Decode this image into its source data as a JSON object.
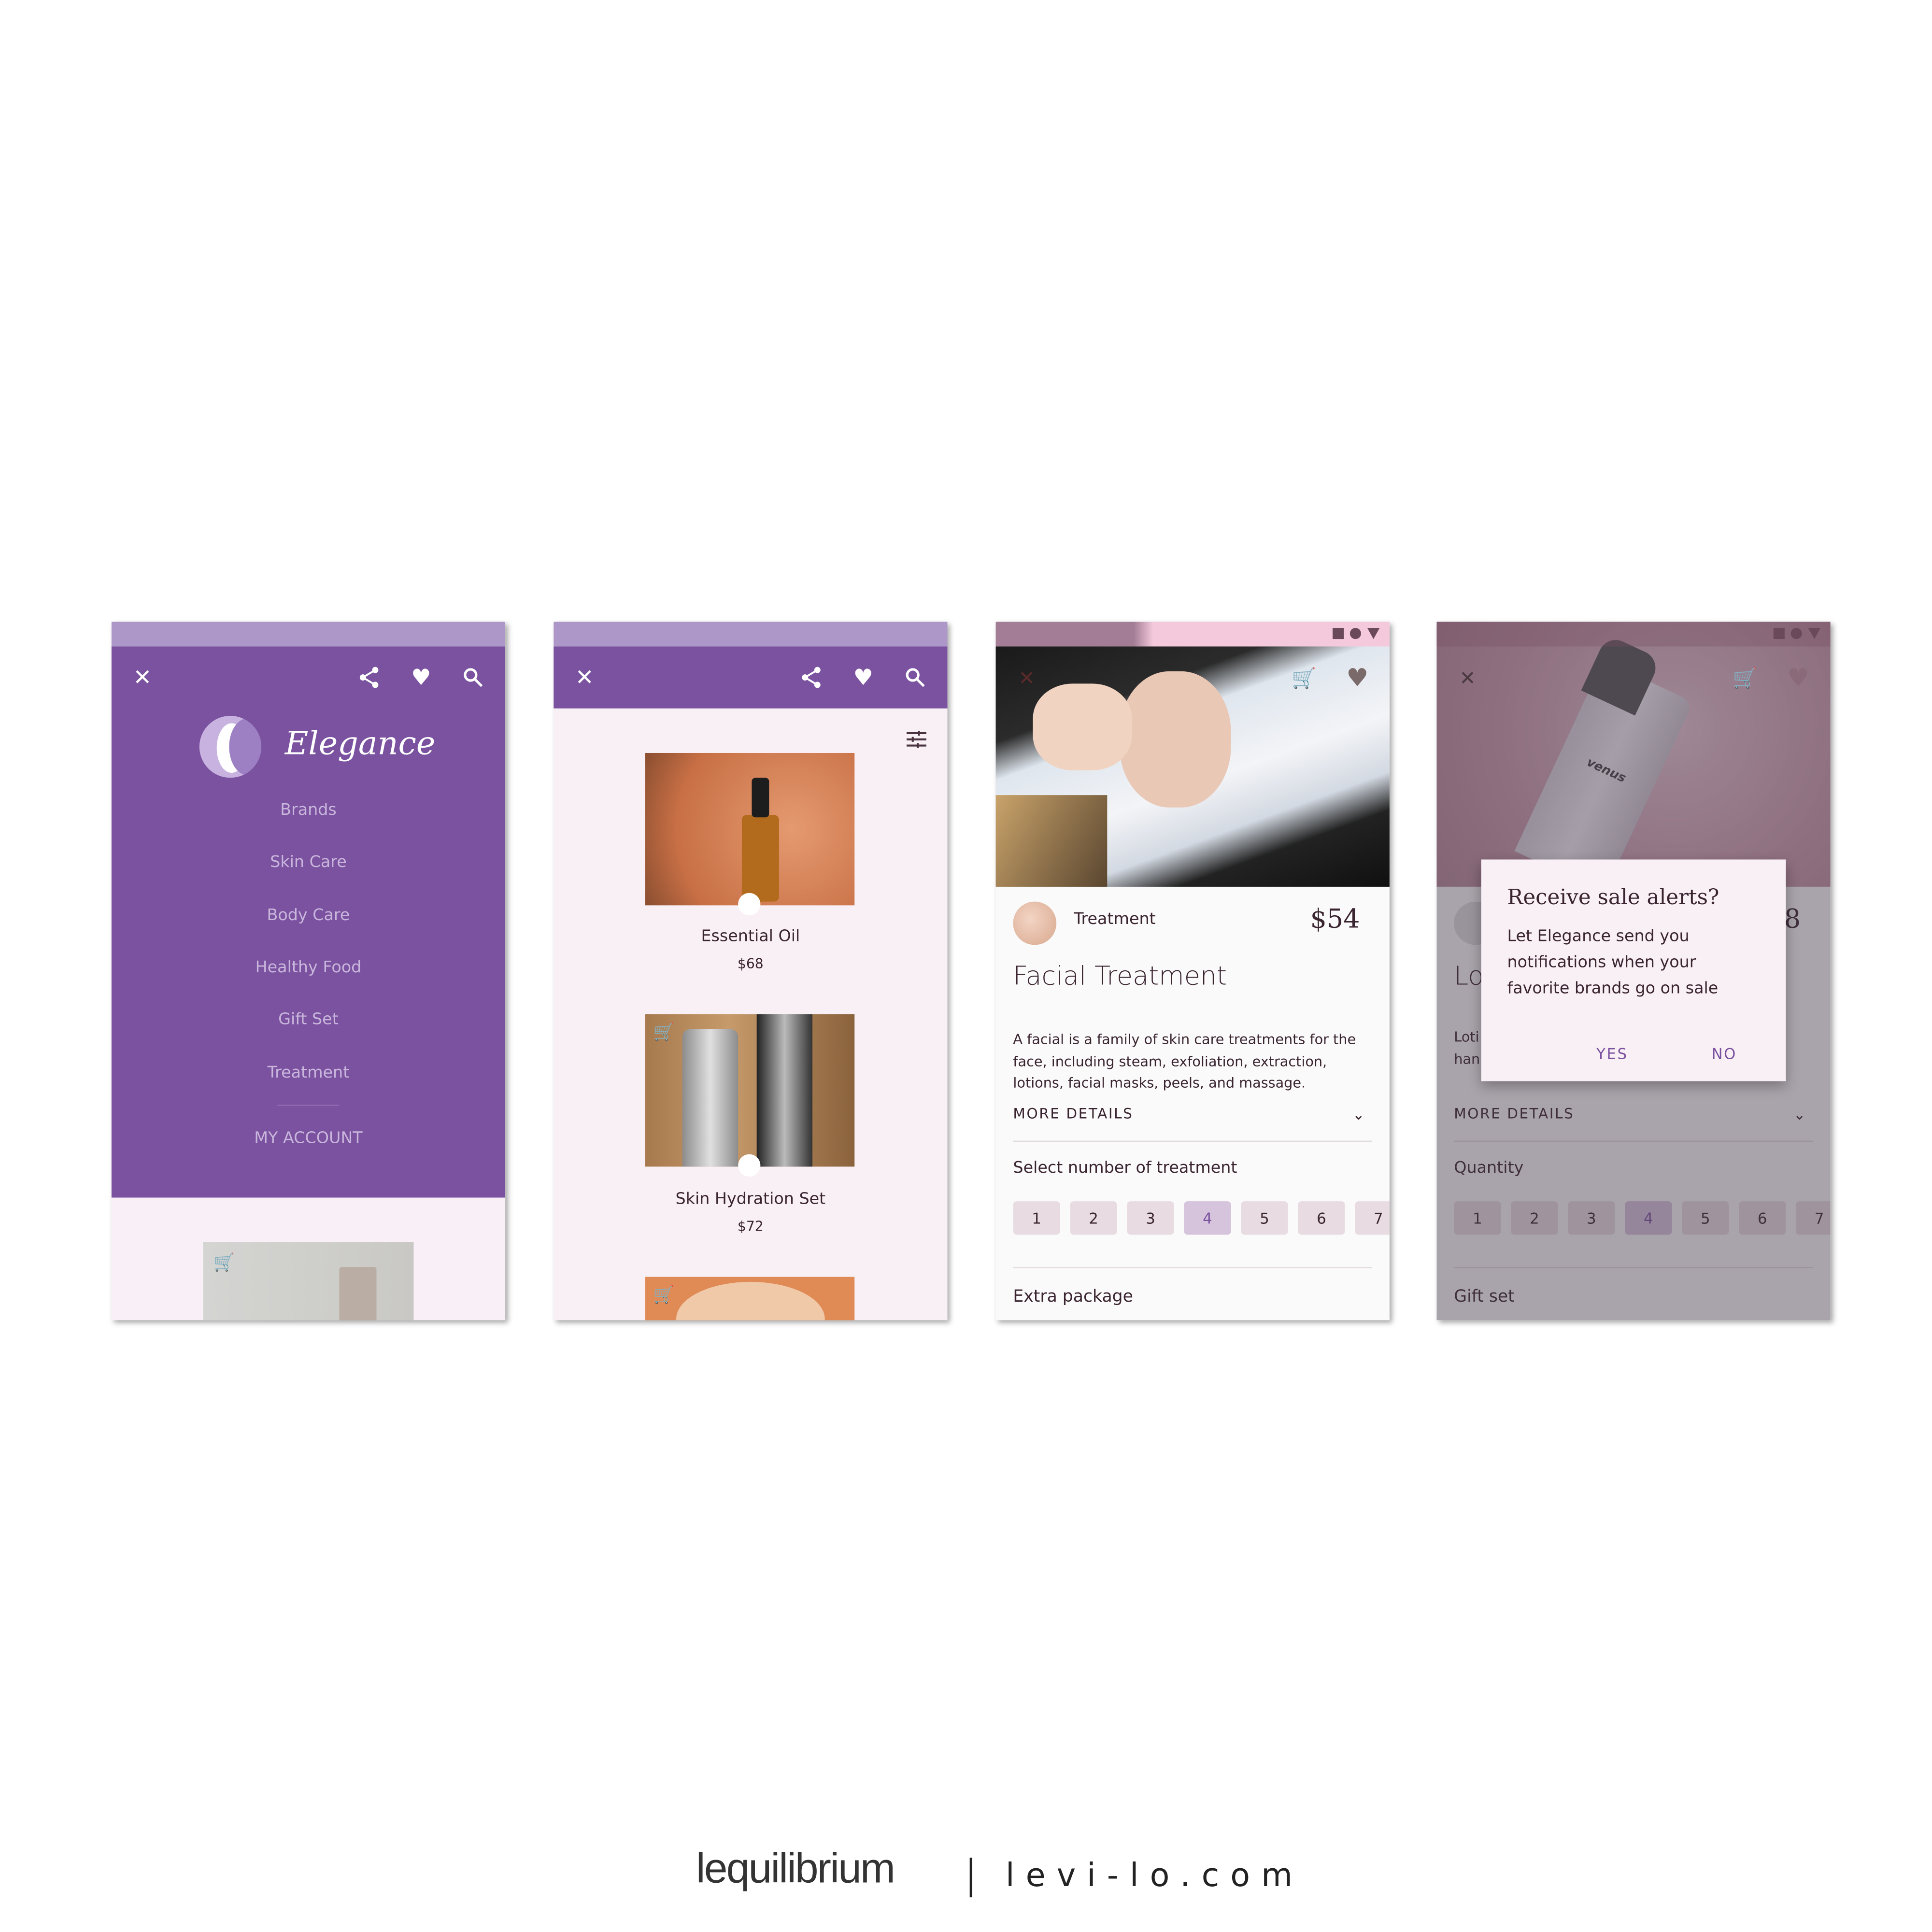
{
  "colors": {
    "primary": "#7b52a0",
    "status_bar": "#ad97c9",
    "surface": "#f9f0f6",
    "accent_selected": "#d6c3dc"
  },
  "icons": [
    "close-icon",
    "share-icon",
    "heart-icon",
    "search-icon",
    "filter-icon",
    "cart-add-icon",
    "cart-icon",
    "chevron-down-icon"
  ],
  "menu_screen": {
    "brand": "Elegance",
    "items": [
      "Brands",
      "Skin Care",
      "Body Care",
      "Healthy Food",
      "Gift Set",
      "Treatment"
    ],
    "account": "MY ACCOUNT"
  },
  "list_screen": {
    "products": [
      {
        "name": "Essential Oil",
        "price": "$68"
      },
      {
        "name": "Skin Hydration Set",
        "price": "$72"
      }
    ]
  },
  "detail_screen": {
    "category": "Treatment",
    "price": "$54",
    "title": "Facial Treatment",
    "description": "A facial is a family of skin care treatments for the face, including steam, exfoliation, extraction, lotions, facial masks, peels, and massage.",
    "more_details": "MORE DETAILS",
    "select_label": "Select number of treatment",
    "numbers": [
      "1",
      "2",
      "3",
      "4",
      "5",
      "6",
      "7"
    ],
    "selected": "4",
    "extra_label": "Extra package"
  },
  "dialog_screen": {
    "price_fragment": "8",
    "title_fragment": "Lo",
    "desc_fragment_1": "Loti",
    "desc_fragment_2": "han",
    "more_details": "MORE DETAILS",
    "quantity_label": "Quantity",
    "numbers": [
      "1",
      "2",
      "3",
      "4",
      "5",
      "6",
      "7"
    ],
    "selected": "4",
    "gift_label": "Gift set",
    "product_label": "venus",
    "dialog": {
      "title": "Receive sale alerts?",
      "body": "Let Elegance send you notifications when your favorite brands go on sale",
      "yes": "YES",
      "no": "NO"
    }
  },
  "footer": {
    "logo": "lequilibrium",
    "site": "levi-lo.com"
  }
}
